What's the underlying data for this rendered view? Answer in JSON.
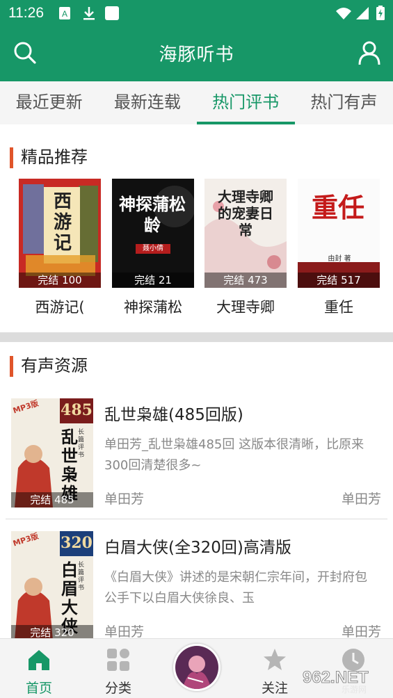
{
  "status": {
    "time": "11:26"
  },
  "app": {
    "title": "海豚听书"
  },
  "tabs": [
    "最近更新",
    "最新连载",
    "热门评书",
    "热门有声"
  ],
  "active_tab": 2,
  "featured": {
    "title": "精品推荐",
    "items": [
      {
        "name": "西游记(",
        "badge": "完结 100",
        "cover_text": "西游记"
      },
      {
        "name": "神探蒲松",
        "badge": "完结 21",
        "cover_text": "神探蒲松龄",
        "cover_sub": "聂小倩"
      },
      {
        "name": "大理寺卿",
        "badge": "完结 473",
        "cover_text": "大理寺卿的宠妻日常"
      },
      {
        "name": "重任",
        "badge": "完结 517",
        "cover_text": "重任",
        "cover_sub": "由封 著"
      }
    ]
  },
  "audio": {
    "title": "有声资源",
    "items": [
      {
        "title": "乱世枭雄(485回版)",
        "desc": "单田芳_乱世枭雄485回 这版本很清晰，比原来300回清楚很多~",
        "author": "单田芳",
        "author_right": "单田芳",
        "badge": "完结 485",
        "cover_num": "485",
        "cover_text": "乱世枭雄",
        "cover_tag": "MP3版",
        "cover_side": "长篇评书"
      },
      {
        "title": "白眉大侠(全320回)高清版",
        "desc": "《白眉大侠》讲述的是宋朝仁宗年间，开封府包公手下以白眉大侠徐良、玉",
        "author": "单田芳",
        "author_right": "单田芳",
        "badge": "完结 320",
        "cover_num": "320",
        "cover_text": "白眉大侠",
        "cover_tag": "MP3版",
        "cover_side": "长篇评书"
      }
    ]
  },
  "bottom_nav": [
    {
      "label": "首页",
      "icon": "home-icon"
    },
    {
      "label": "分类",
      "icon": "category-icon"
    },
    {
      "label": "",
      "icon": "center-cover"
    },
    {
      "label": "关注",
      "icon": "star-icon"
    },
    {
      "label": "",
      "icon": "history-icon"
    }
  ],
  "watermark": {
    "text": "962.NET",
    "sub": "乐游网"
  },
  "colors": {
    "primary": "#179767",
    "accent_bar": "#e0552a"
  }
}
